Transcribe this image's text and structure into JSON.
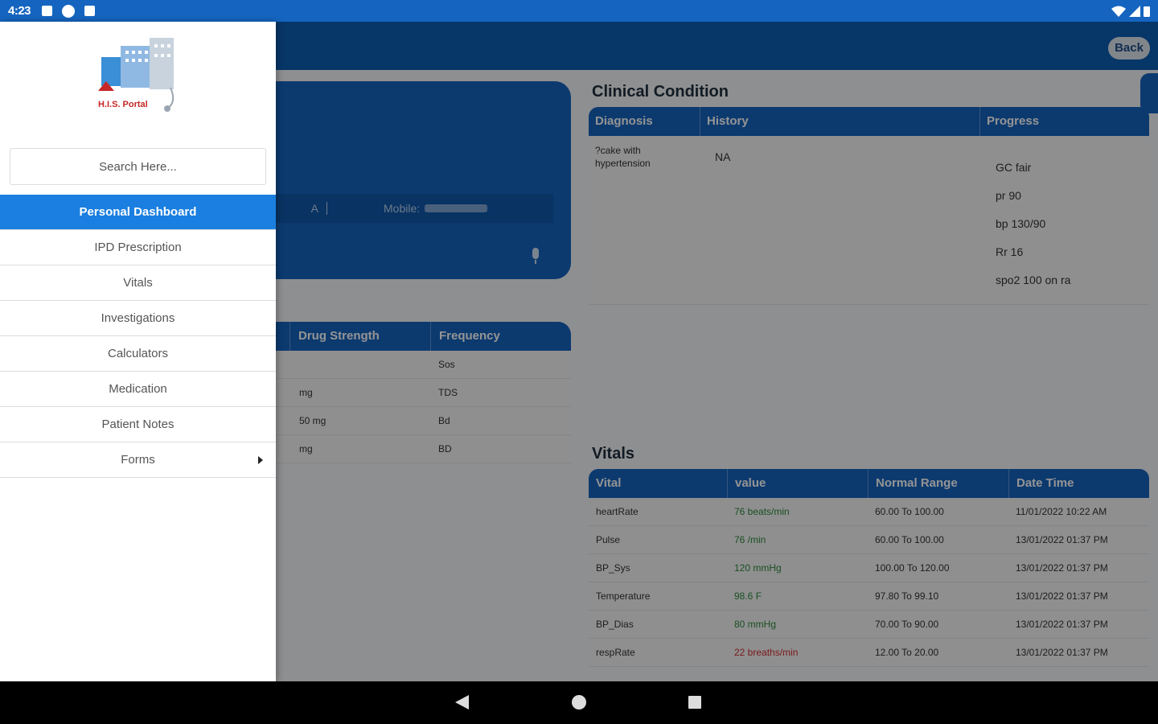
{
  "status_bar": {
    "time": "4:23",
    "icons": [
      "notification-icon",
      "podcast-icon",
      "sd-card-icon",
      "wifi-icon",
      "signal-icon",
      "battery-icon"
    ]
  },
  "app_bar": {
    "back_label": "Back"
  },
  "patient_card": {
    "info_fragment": "A",
    "mobile_label": "Mobile:"
  },
  "medications": {
    "headers": [
      "Drug Strength",
      "Frequency"
    ],
    "rows": [
      {
        "strength": "",
        "frequency": "Sos"
      },
      {
        "strength": "mg",
        "frequency": "TDS"
      },
      {
        "strength": "50 mg",
        "frequency": "Bd"
      },
      {
        "strength": "mg",
        "frequency": "BD"
      }
    ]
  },
  "clinical_condition": {
    "title": "Clinical Condition",
    "headers": [
      "Diagnosis",
      "History",
      "Progress"
    ],
    "diagnosis": "?cake with hypertension",
    "history": "NA",
    "progress": [
      "GC fair",
      "pr 90",
      "bp 130/90",
      "Rr 16",
      "spo2 100 on ra"
    ]
  },
  "vitals": {
    "title": "Vitals",
    "headers": [
      "Vital",
      "value",
      "Normal Range",
      "Date Time"
    ],
    "rows": [
      {
        "vital": "heartRate",
        "value": "76 beats/min",
        "range": "60.00 To 100.00",
        "datetime": "11/01/2022 10:22 AM",
        "status": "normal"
      },
      {
        "vital": "Pulse",
        "value": "76 /min",
        "range": "60.00 To 100.00",
        "datetime": "13/01/2022 01:37 PM",
        "status": "normal"
      },
      {
        "vital": "BP_Sys",
        "value": "120 mmHg",
        "range": "100.00 To 120.00",
        "datetime": "13/01/2022 01:37 PM",
        "status": "normal"
      },
      {
        "vital": "Temperature",
        "value": "98.6 F",
        "range": "97.80 To 99.10",
        "datetime": "13/01/2022 01:37 PM",
        "status": "normal"
      },
      {
        "vital": "BP_Dias",
        "value": "80 mmHg",
        "range": "70.00 To 90.00",
        "datetime": "13/01/2022 01:37 PM",
        "status": "normal"
      },
      {
        "vital": "respRate",
        "value": "22 breaths/min",
        "range": "12.00 To 20.00",
        "datetime": "13/01/2022 01:37 PM",
        "status": "high"
      }
    ]
  },
  "drawer": {
    "logo_text": "H.I.S. Portal",
    "search_placeholder": "Search Here...",
    "menu_items": [
      "Personal Dashboard",
      "IPD Prescription",
      "Vitals",
      "Investigations",
      "Calculators",
      "Medication",
      "Patient Notes",
      "Forms"
    ],
    "active_index": 0
  },
  "colors": {
    "primary": "#1664c0",
    "status_bar": "#1565c0",
    "drawer_active": "#1a7fe0",
    "value_normal": "#2e8b3a",
    "value_high": "#d32f2f"
  }
}
